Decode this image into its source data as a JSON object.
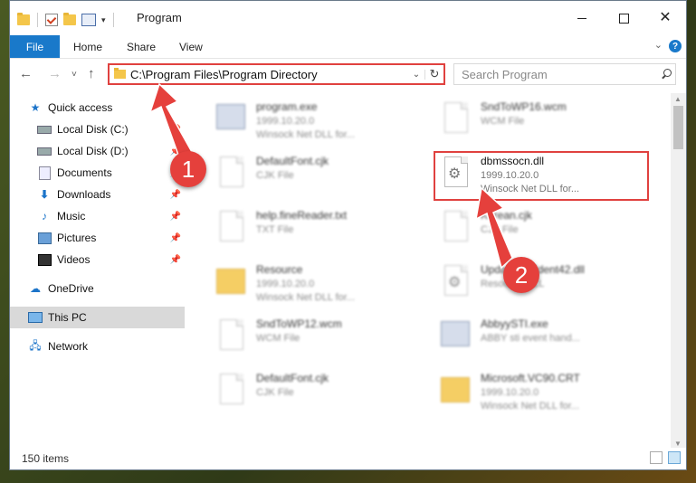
{
  "window": {
    "title": "Program",
    "minimize": "–",
    "close": "✕"
  },
  "ribbon": {
    "tabs": [
      "File",
      "Home",
      "Share",
      "View"
    ],
    "help": "?"
  },
  "address": {
    "path": "C:\\Program Files\\Program Directory",
    "refresh": "↻"
  },
  "search": {
    "placeholder": "Search Program"
  },
  "nav_buttons": {
    "back": "←",
    "forward": "→",
    "recent": "˅",
    "up": "↑"
  },
  "navpane": {
    "items": [
      {
        "label": "Quick access",
        "icon": "star-icon"
      },
      {
        "label": "Local Disk (C:)",
        "icon": "disk-icon",
        "pinned": true
      },
      {
        "label": "Local Disk (D:)",
        "icon": "disk-icon",
        "pinned": true
      },
      {
        "label": "Documents",
        "icon": "documents-icon",
        "pinned": true
      },
      {
        "label": "Downloads",
        "icon": "download-icon",
        "pinned": true
      },
      {
        "label": "Music",
        "icon": "music-icon",
        "pinned": true
      },
      {
        "label": "Pictures",
        "icon": "pictures-icon",
        "pinned": true
      },
      {
        "label": "Videos",
        "icon": "videos-icon",
        "pinned": true
      },
      {
        "label": "OneDrive",
        "icon": "cloud-icon"
      },
      {
        "label": "This PC",
        "icon": "pc-icon",
        "selected": true
      },
      {
        "label": "Network",
        "icon": "network-icon"
      }
    ]
  },
  "files": [
    {
      "name": "program.exe",
      "line1": "1999.10.20.0",
      "line2": "Winsock Net DLL for...",
      "icon": "exe-icon",
      "blurred": true
    },
    {
      "name": "SndToWP16.wcm",
      "line1": "WCM File",
      "line2": "",
      "icon": "document-icon",
      "blurred": true
    },
    {
      "name": "DefaultFont.cjk",
      "line1": "CJK File",
      "line2": "",
      "icon": "document-icon",
      "blurred": true
    },
    {
      "name": "dbmssocn.dll",
      "line1": "1999.10.20.0",
      "line2": "Winsock Net DLL for...",
      "icon": "dll-gear-icon",
      "blurred": false
    },
    {
      "name": "help.fineReader.txt",
      "line1": "TXT File",
      "line2": "",
      "icon": "document-icon",
      "blurred": true
    },
    {
      "name": "Korean.cjk",
      "line1": "CJK File",
      "line2": "",
      "icon": "document-icon",
      "blurred": true
    },
    {
      "name": "Resource",
      "line1": "1999.10.20.0",
      "line2": "Winsock Net DLL for...",
      "icon": "folder-icon",
      "blurred": true
    },
    {
      "name": "UpdateResident42.dll",
      "line1": "Resource DLL",
      "line2": "",
      "icon": "dll-gear-icon",
      "blurred": true
    },
    {
      "name": "SndToWP12.wcm",
      "line1": "WCM File",
      "line2": "",
      "icon": "document-icon",
      "blurred": true
    },
    {
      "name": "AbbyySTI.exe",
      "line1": "ABBY sti event hand...",
      "line2": "",
      "icon": "exe-icon",
      "blurred": true
    },
    {
      "name": "DefaultFont.cjk",
      "line1": "CJK File",
      "line2": "",
      "icon": "document-icon",
      "blurred": true
    },
    {
      "name": "Microsoft.VC90.CRT",
      "line1": "1999.10.20.0",
      "line2": "Winsock Net DLL for...",
      "icon": "folder-icon",
      "blurred": true
    }
  ],
  "status": {
    "count": "150 items"
  },
  "annotations": {
    "callout1": "1",
    "callout2": "2",
    "color": "#e5403c"
  }
}
